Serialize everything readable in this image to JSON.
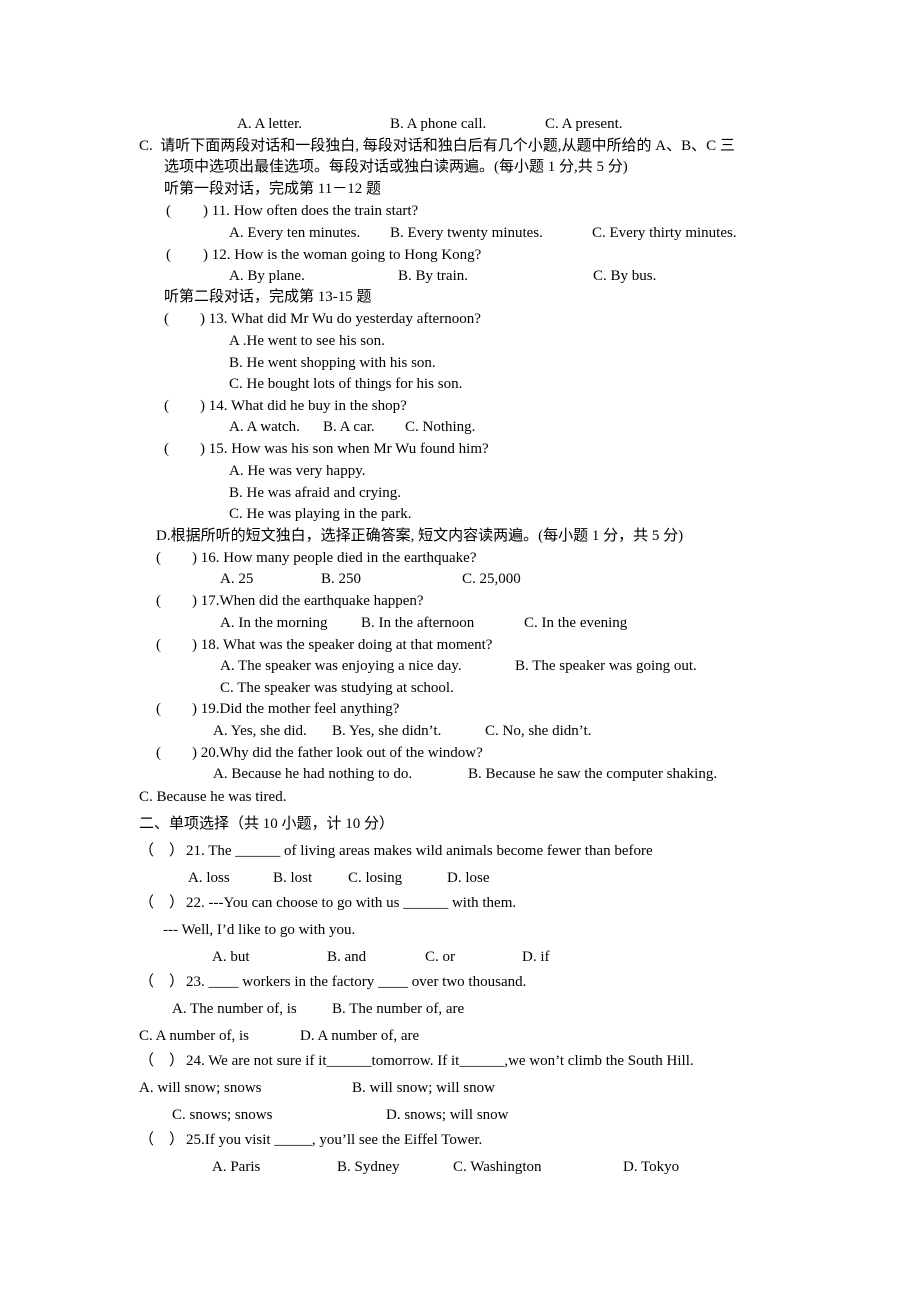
{
  "q10_options": {
    "a": "A. A letter.",
    "b": "B. A phone call.",
    "c": "C. A present."
  },
  "sectionC": {
    "instruction_line1": "C.  请听下面两段对话和一段独白, 每段对话和独白后有几个小题,从题中所给的 A、B、C 三",
    "instruction_line2": "选项中选项出最佳选项。每段对话或独白读两遍。(每小题 1 分,共 5 分)",
    "dialog1_heading": "听第一段对话，完成第 11－12 题",
    "dialog2_heading": "听第二段对话，完成第 13-15 题"
  },
  "paren": "(        )",
  "q11": {
    "stem": ") 11. How often does the train start?",
    "a": "A. Every ten minutes.",
    "b": "B. Every twenty minutes.",
    "c": "C. Every thirty minutes."
  },
  "q12": {
    "stem": ") 12. How is the woman going to Hong Kong?",
    "a": "A. By plane.",
    "b": "B. By train.",
    "c": "C. By bus."
  },
  "q13": {
    "stem": ") 13. What did Mr Wu do yesterday afternoon?",
    "a": "A .He went to see his son.",
    "b": "B. He went shopping with his son.",
    "c": "C. He bought lots of things for his son."
  },
  "q14": {
    "stem": ") 14. What did he buy in the shop?",
    "a": "A. A watch.",
    "b": "B. A car.",
    "c": "C. Nothing."
  },
  "q15": {
    "stem": ") 15. How was his son when Mr Wu found him?",
    "a": "A. He was very happy.",
    "b": "B. He was afraid and crying.",
    "c": "C. He was playing in the park."
  },
  "sectionD": {
    "instruction": "D.根据所听的短文独白，选择正确答案, 短文内容读两遍。(每小题 1 分，共 5 分)"
  },
  "q16": {
    "stem": ") 16. How many people died in the earthquake?",
    "a": "A. 25",
    "b": "B. 250",
    "c": "C. 25,000"
  },
  "q17": {
    "stem": ") 17.When did the earthquake happen?",
    "a": "A. In the morning",
    "b": "B. In the afternoon",
    "c": "C. In the evening"
  },
  "q18": {
    "stem": ") 18. What was the speaker doing at that moment?",
    "a": "A. The speaker was enjoying a nice day.",
    "b": "B. The speaker was going out.",
    "c": "C. The speaker was studying at school."
  },
  "q19": {
    "stem": ") 19.Did the mother feel anything?",
    "a": "A. Yes, she did.",
    "b": "B. Yes, she didn’t.",
    "c": "C. No, she didn’t."
  },
  "q20": {
    "stem": ") 20.Why did the father look out of the window?",
    "a": "A. Because he had nothing to do.",
    "b": "B. Because he saw the computer shaking.",
    "c": "C. Because he was tired."
  },
  "part2": {
    "heading": "二、单项选择（共 10 小题，计 10 分）"
  },
  "paren2": "（    ）",
  "q21": {
    "stem": "21. The ______ of living areas makes wild animals become fewer than before",
    "a": "A. loss",
    "b": "B. lost",
    "c": "C. losing",
    "d": "D. lose"
  },
  "q22": {
    "stem": "22. ---You can choose to go with us ______ with them.",
    "reply": "--- Well, I’d like to go with you.",
    "a": "A. but",
    "b": "B. and",
    "c": "C. or",
    "d": "D. if"
  },
  "q23": {
    "stem": "23. ____ workers in the factory ____ over two thousand.",
    "a": "A. The number of, is",
    "b": "B. The number of, are",
    "c": "C. A number of, is",
    "d": "D. A number of, are"
  },
  "q24": {
    "stem": "24. We are not sure if it______tomorrow. If it______,we won’t climb the South Hill.",
    "a": "A. will snow; snows",
    "b": "B. will snow; will snow",
    "c": "C. snows; snows",
    "d": "D. snows; will snow"
  },
  "q25": {
    "stem": "25.If you visit _____, you’ll see the Eiffel Tower.",
    "a": "A. Paris",
    "b": "B. Sydney",
    "c": "C. Washington",
    "d": "D. Tokyo"
  }
}
